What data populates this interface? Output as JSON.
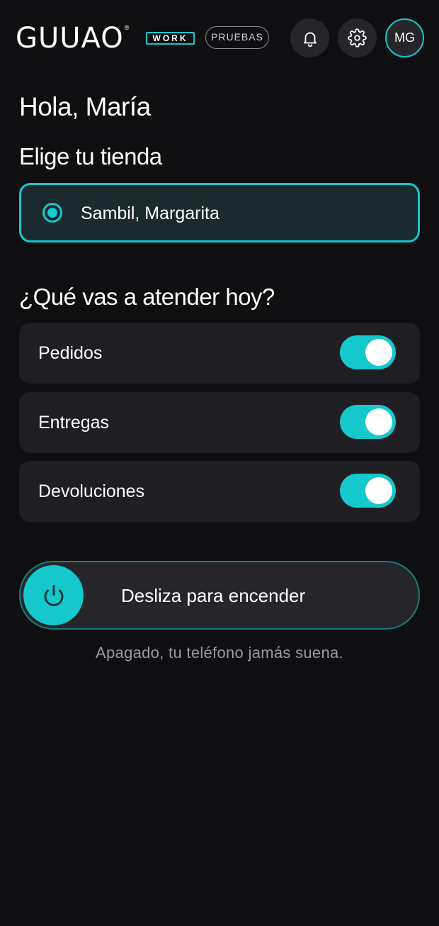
{
  "header": {
    "brand": "GUUAO",
    "brand_mark": "®",
    "product_badge": "WORK",
    "environment_pill": "PRUEBAS",
    "notifications_icon": "bell-icon",
    "settings_icon": "gear-icon",
    "avatar_initials": "MG"
  },
  "greeting": "Hola, María",
  "store_section": {
    "title": "Elige tu tienda",
    "selected_store": "Sambil, Margarita"
  },
  "attend_section": {
    "title": "¿Qué vas a atender hoy?",
    "options": [
      {
        "label": "Pedidos",
        "enabled": true
      },
      {
        "label": "Entregas",
        "enabled": true
      },
      {
        "label": "Devoluciones",
        "enabled": true
      }
    ]
  },
  "power": {
    "icon": "power-icon",
    "label": "Desliza para encender",
    "hint": "Apagado, tu teléfono jamás suena."
  },
  "colors": {
    "accent": "#14c8cc",
    "background": "#0f0f11",
    "card": "#1f1f23",
    "selected_card": "#1b2a2f",
    "muted_text": "#9a9aa0"
  }
}
